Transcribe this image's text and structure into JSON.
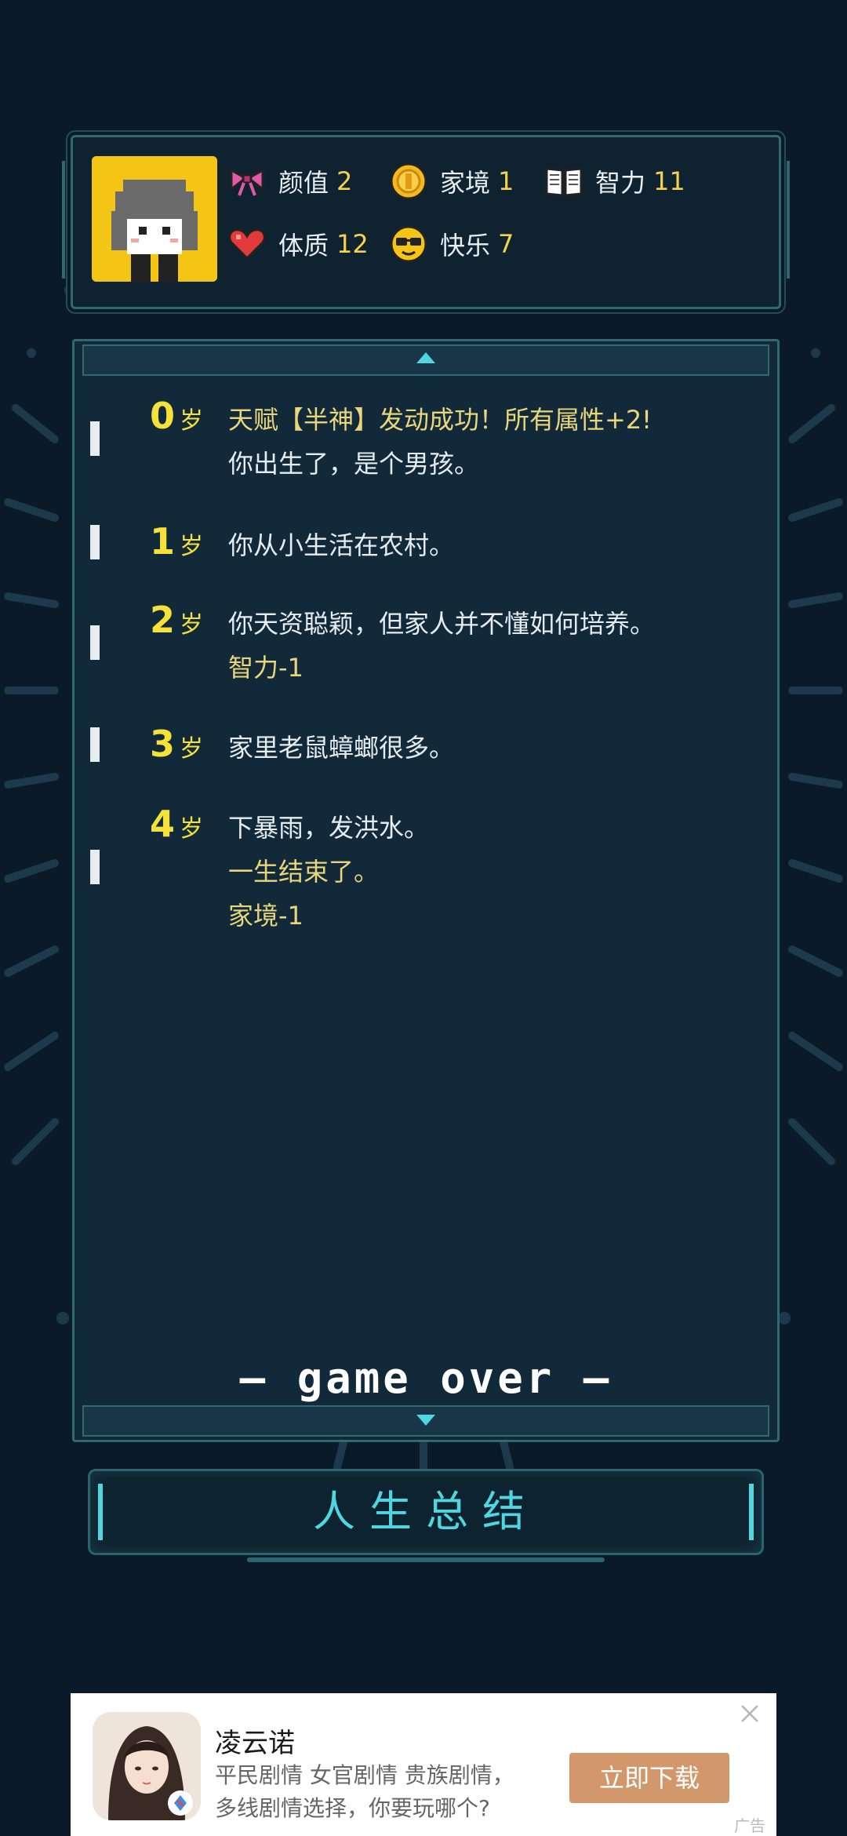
{
  "stats": [
    {
      "label": "颜值",
      "value": "2",
      "icon": "bow-icon"
    },
    {
      "label": "家境",
      "value": "1",
      "icon": "coin-icon"
    },
    {
      "label": "智力",
      "value": "11",
      "icon": "book-icon"
    },
    {
      "label": "体质",
      "value": "12",
      "icon": "heart-icon"
    },
    {
      "label": "快乐",
      "value": "7",
      "icon": "sunglasses-face-icon"
    }
  ],
  "log": {
    "age_unit": "岁",
    "entries": [
      {
        "age": "0",
        "lines": [
          {
            "text": "天赋【半神】发动成功！所有属性+2!",
            "style": "gold"
          },
          {
            "text": "你出生了，是个男孩。",
            "style": "normal"
          }
        ]
      },
      {
        "age": "1",
        "lines": [
          {
            "text": "你从小生活在农村。",
            "style": "normal"
          }
        ]
      },
      {
        "age": "2",
        "lines": [
          {
            "text": "你天资聪颖，但家人并不懂如何培养。",
            "style": "normal"
          },
          {
            "text": "智力-1",
            "style": "gold"
          }
        ]
      },
      {
        "age": "3",
        "lines": [
          {
            "text": "家里老鼠蟑螂很多。",
            "style": "normal"
          }
        ]
      },
      {
        "age": "4",
        "lines": [
          {
            "text": "下暴雨，发洪水。",
            "style": "normal"
          },
          {
            "text": "一生结束了。",
            "style": "gold"
          },
          {
            "text": "家境-1",
            "style": "gold"
          }
        ]
      }
    ],
    "game_over": "— game over —"
  },
  "summary_button": "人生总结",
  "ad": {
    "title": "凌云诺",
    "desc_line1": "平民剧情 女官剧情 贵族剧情，",
    "desc_line2": "多线剧情选择，你要玩哪个?",
    "download": "立即下载",
    "tag": "广告"
  },
  "colors": {
    "background": "#0b1a28",
    "panel": "#12293a",
    "border": "#2f6a70",
    "accent": "#4fd6e0",
    "age": "#f4e23a",
    "gold_text": "#ead67a",
    "ad_button": "#d2976a"
  }
}
